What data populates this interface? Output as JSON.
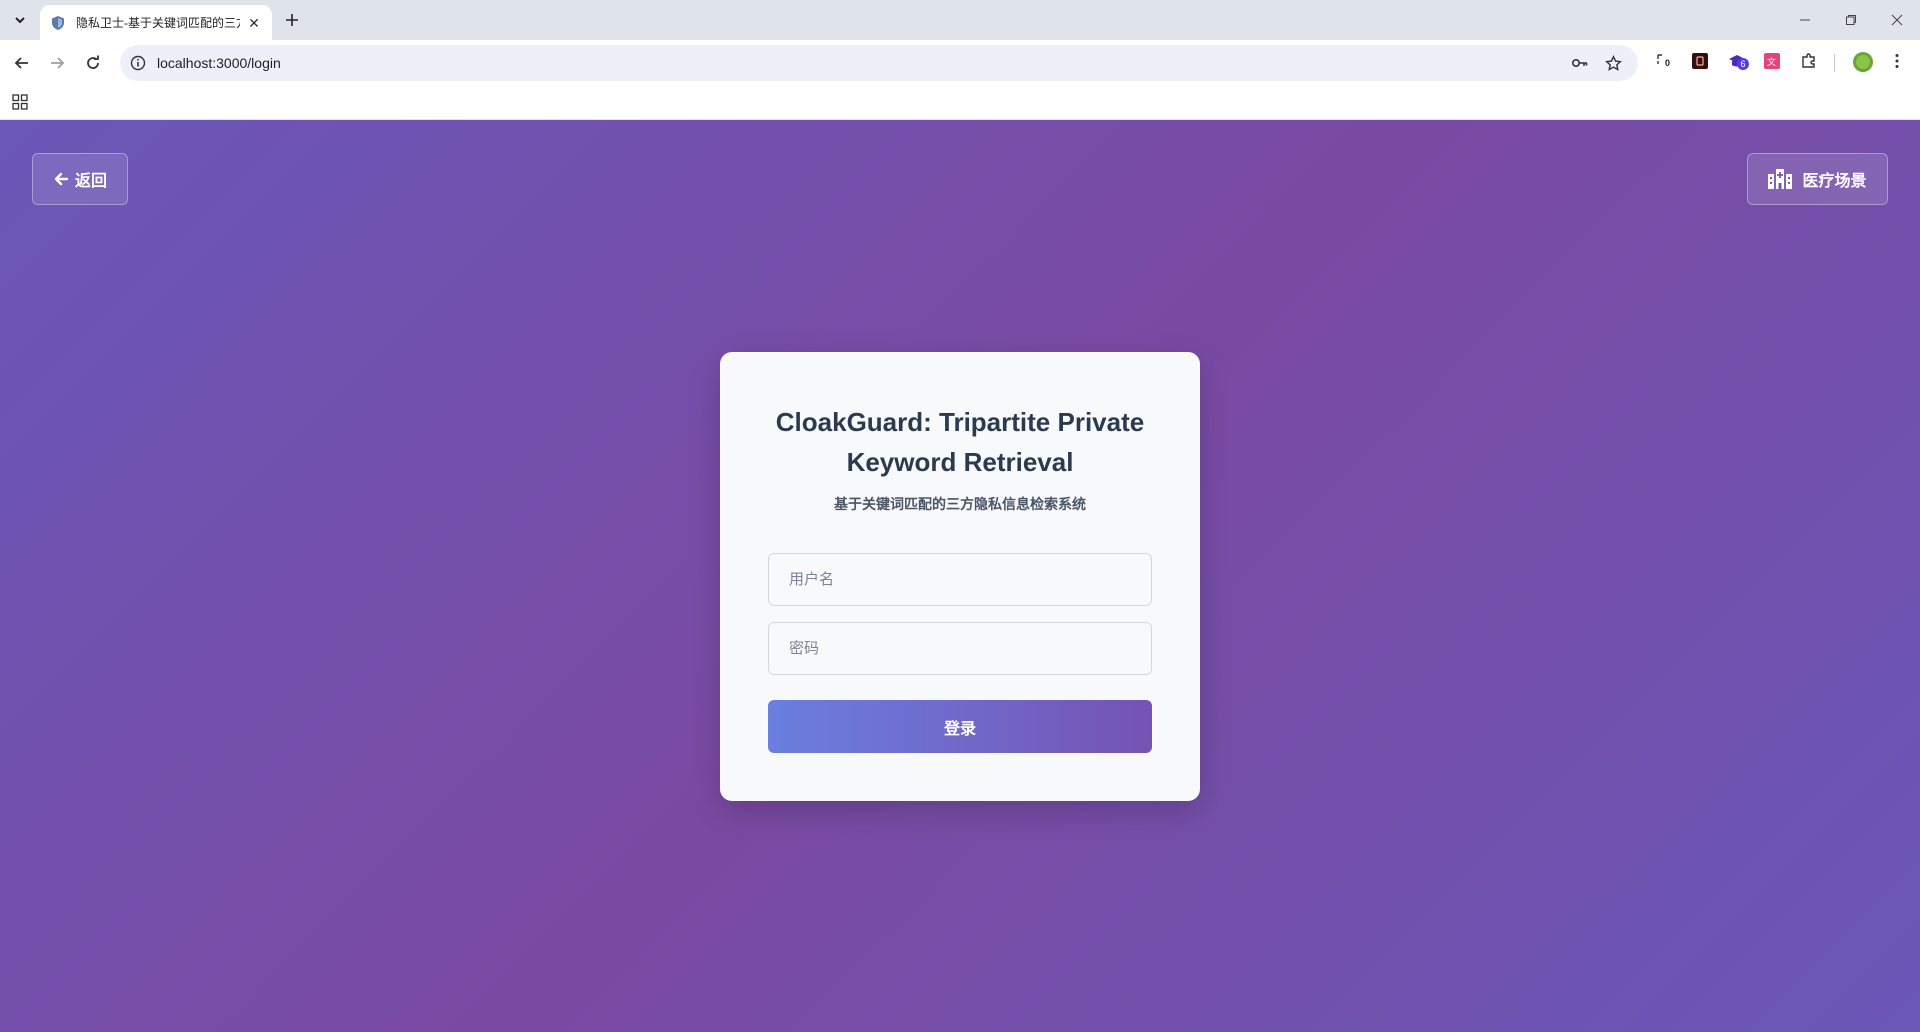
{
  "browser": {
    "tab": {
      "title": "隐私卫士-基于关键词匹配的三方"
    },
    "url": "localhost:3000/login",
    "extension_badges": {
      "ext1": "0",
      "ext3": "6"
    }
  },
  "page": {
    "back_label": "返回",
    "scene_label": "医疗场景",
    "card": {
      "title": "CloakGuard: Tripartite Private Keyword Retrieval",
      "subtitle": "基于关键词匹配的三方隐私信息检索系统",
      "username_placeholder": "用户名",
      "password_placeholder": "密码",
      "login_label": "登录"
    }
  },
  "colors": {
    "background_gradient": [
      "#6a57b8",
      "#7a4aa2"
    ],
    "button_gradient": [
      "#6a7fe0",
      "#7553b4"
    ],
    "card_bg": "#f8f9fb",
    "title_color": "#2c3a4e"
  }
}
